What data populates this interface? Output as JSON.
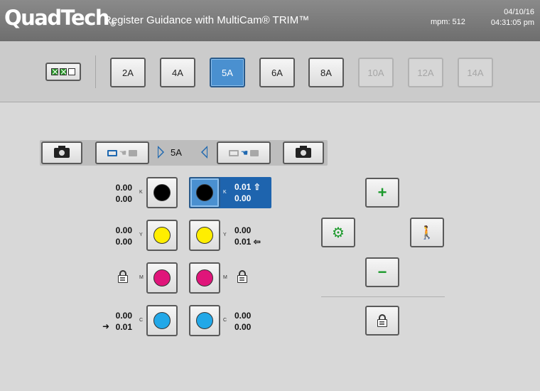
{
  "header": {
    "logo": "QuadTech",
    "logo_mark": "®",
    "title": "Register Guidance with MultiCam® TRIM™",
    "date": "04/10/16",
    "mpm": "mpm:  512",
    "time": "04:31:05 pm"
  },
  "unit_selector": {
    "checks": [
      "checked",
      "checked",
      "unchecked"
    ],
    "icon": "checkbox-icon"
  },
  "tabs": [
    {
      "label": "2A",
      "state": "normal"
    },
    {
      "label": "4A",
      "state": "normal"
    },
    {
      "label": "5A",
      "state": "active"
    },
    {
      "label": "6A",
      "state": "normal"
    },
    {
      "label": "8A",
      "state": "normal"
    },
    {
      "label": "10A",
      "state": "disabled"
    },
    {
      "label": "12A",
      "state": "disabled"
    },
    {
      "label": "14A",
      "state": "disabled"
    }
  ],
  "camera_bar": {
    "unit": "5A",
    "left_camera_icon": "camera-icon",
    "right_camera_icon": "camera-icon"
  },
  "colors": {
    "K": {
      "letter": "K",
      "swatch": "#000000",
      "left": [
        "0.00",
        "0.00"
      ],
      "right": [
        "0.01",
        "0.00"
      ],
      "right_indicator": "⇧"
    },
    "Y": {
      "letter": "Y",
      "swatch": "#ffee00",
      "left": [
        "0.00",
        "0.00"
      ],
      "right": [
        "0.00",
        "0.01"
      ],
      "right_indicator": "⇦"
    },
    "M": {
      "letter": "M",
      "swatch": "#e0157a"
    },
    "C": {
      "letter": "C",
      "swatch": "#22a8e8",
      "left": [
        "0.00",
        "0.01"
      ],
      "left_indicator": "➜",
      "right": [
        "0.00",
        "0.00"
      ]
    }
  },
  "controls": {
    "plus": "+",
    "minus": "−",
    "gear": "⚙",
    "person": "🚶"
  },
  "accent_colors": {
    "active_tab": "#4a90d0",
    "selected_panel": "#1e64ae",
    "control_green": "#1c9a2c"
  }
}
